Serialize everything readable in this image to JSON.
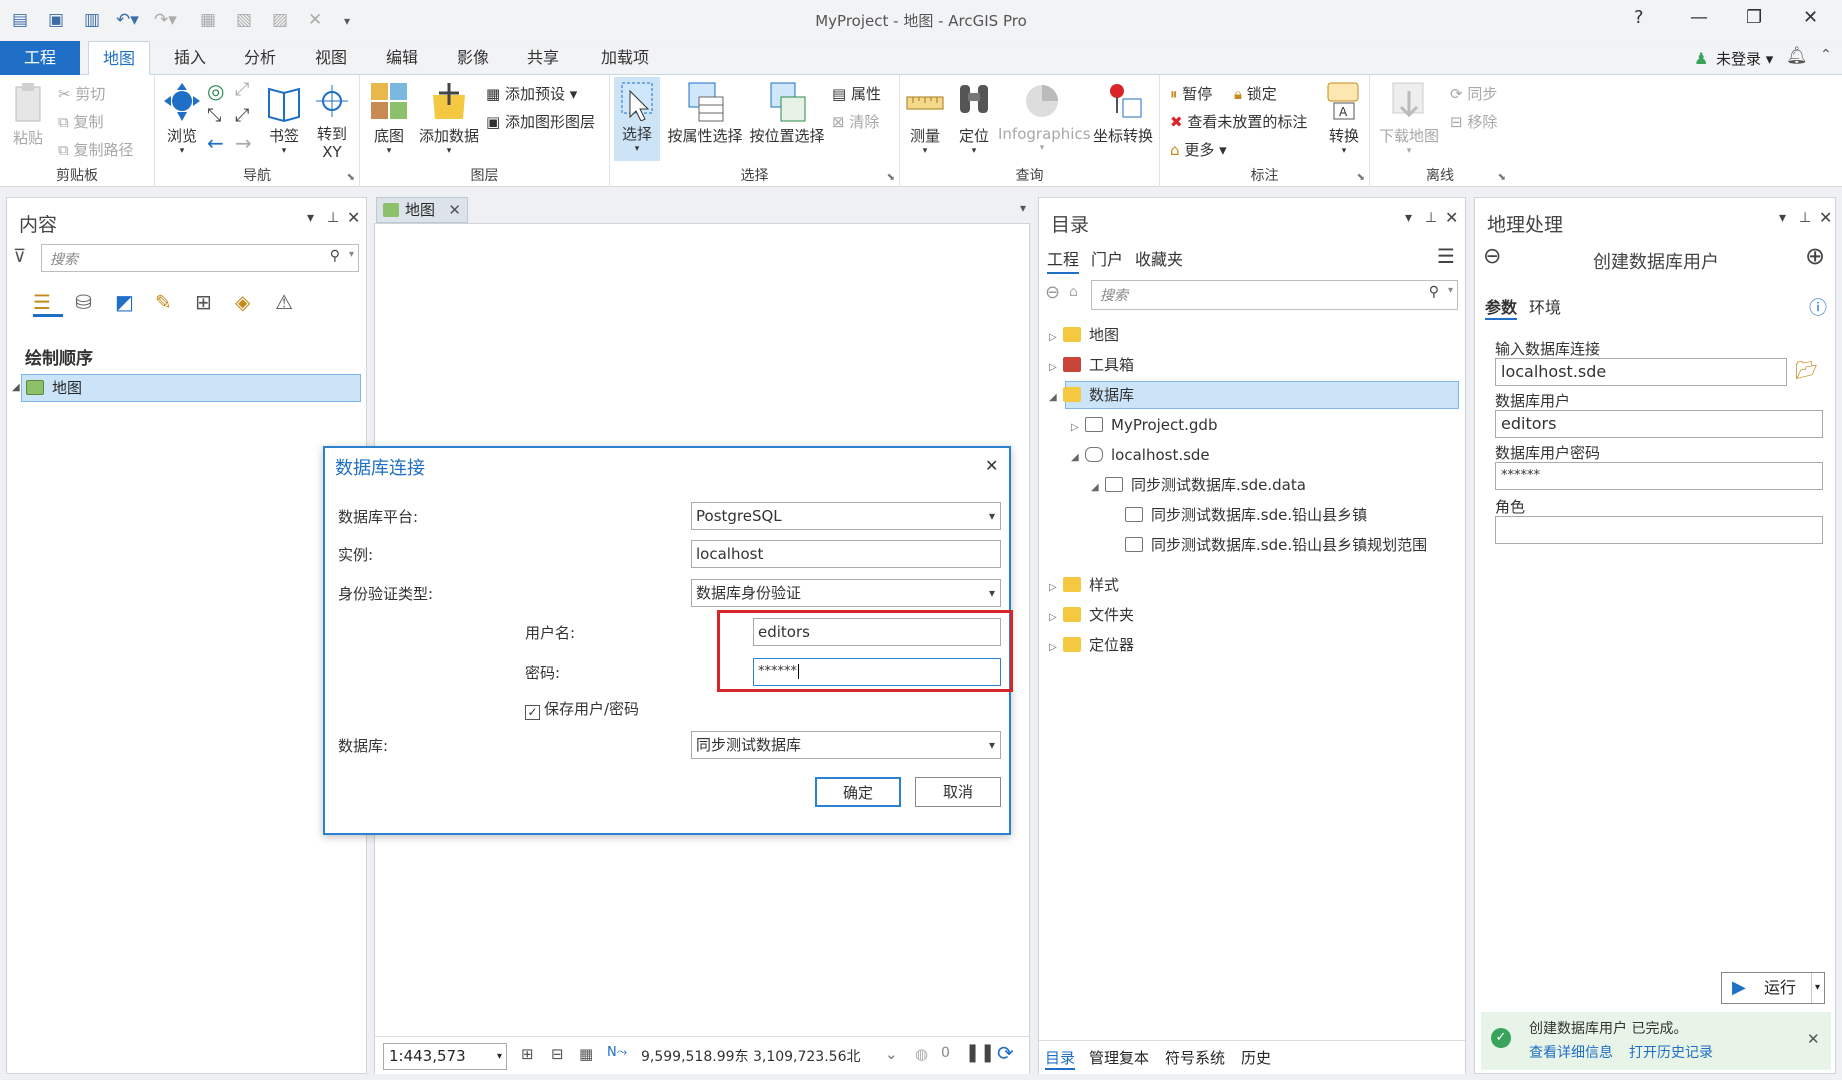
{
  "window": {
    "title": "MyProject - 地图 - ArcGIS Pro",
    "help": "?",
    "user": "未登录"
  },
  "tabs": [
    "工程",
    "地图",
    "插入",
    "分析",
    "视图",
    "编辑",
    "影像",
    "共享",
    "加载项"
  ],
  "ribbon": {
    "clipboard": {
      "label": "剪贴板",
      "paste": "粘贴",
      "cut": "剪切",
      "copy": "复制",
      "copy_path": "复制路径"
    },
    "navigate": {
      "label": "导航",
      "explore": "浏览",
      "bookmarks": "书签",
      "goto_xy": "转到\nXY"
    },
    "layer": {
      "label": "图层",
      "basemap": "底图",
      "add_data": "添加数据",
      "add_preset": "添加预设",
      "add_graphics": "添加图形图层"
    },
    "selection": {
      "label": "选择",
      "select": "选择",
      "by_attr": "按属性选择",
      "by_loc": "按位置选择",
      "attributes": "属性",
      "clear": "清除"
    },
    "inquiry": {
      "label": "查询",
      "measure": "测量",
      "locate": "定位",
      "infographics": "Infographics",
      "coord": "坐标转换"
    },
    "labeling": {
      "label": "标注",
      "pause": "暂停",
      "lock": "锁定",
      "unplaced": "查看未放置的标注",
      "more": "更多",
      "convert": "转换"
    },
    "offline": {
      "label": "离线",
      "download": "下载地图",
      "sync": "同步",
      "remove": "移除"
    }
  },
  "contents": {
    "title": "内容",
    "search_placeholder": "搜索",
    "drawing_order": "绘制顺序",
    "map_item": "地图"
  },
  "map_view": {
    "tab": "地图",
    "scale": "1:443,573",
    "coords": "9,599,518.99东 3,109,723.56北 m",
    "count": "0"
  },
  "catalog": {
    "title": "目录",
    "tabs": [
      "工程",
      "门户",
      "收藏夹"
    ],
    "search_placeholder": "搜索",
    "tree": [
      "地图",
      "工具箱",
      "数据库",
      "MyProject.gdb",
      "localhost.sde",
      "同步测试数据库.sde.data",
      "同步测试数据库.sde.铅山县乡镇",
      "同步测试数据库.sde.铅山县乡镇规划范围",
      "样式",
      "文件夹",
      "定位器"
    ],
    "bottom_tabs": [
      "目录",
      "管理复本",
      "符号系统",
      "历史"
    ]
  },
  "geoprocessing": {
    "title": "地理处理",
    "tool": "创建数据库用户",
    "tabs": [
      "参数",
      "环境"
    ],
    "input_conn_label": "输入数据库连接",
    "input_conn": "localhost.sde",
    "db_user_label": "数据库用户",
    "db_user": "editors",
    "pwd_label": "数据库用户密码",
    "pwd": "******",
    "role_label": "角色",
    "role": "",
    "run": "运行",
    "msg": "创建数据库用户 已完成。",
    "details": "查看详细信息",
    "history": "打开历史记录"
  },
  "dialog": {
    "title": "数据库连接",
    "platform_label": "数据库平台:",
    "platform": "PostgreSQL",
    "instance_label": "实例:",
    "instance": "localhost",
    "auth_label": "身份验证类型:",
    "auth": "数据库身份验证",
    "user_label": "用户名:",
    "user": "editors",
    "pwd_label": "密码:",
    "pwd": "******",
    "save_label": "保存用户/密码",
    "db_label": "数据库:",
    "db": "同步测试数据库",
    "ok": "确定",
    "cancel": "取消"
  },
  "colors": {
    "accent": "#1f6fc6",
    "highlight": "#cce4f7",
    "annotation_red": "#d9252a",
    "success": "#3aa35b"
  }
}
